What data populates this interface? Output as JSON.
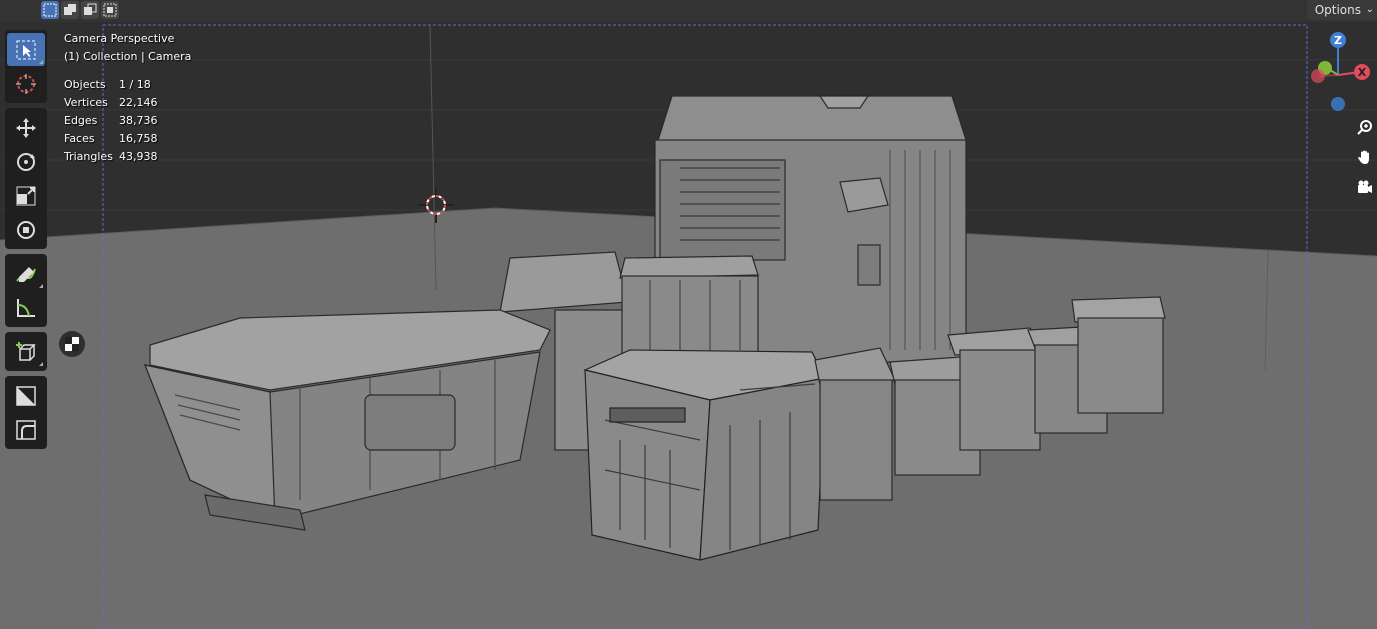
{
  "header": {
    "options_label": "Options",
    "selection_modes": [
      "select-new-icon",
      "select-extend-icon",
      "select-subtract-icon",
      "select-intersect-icon"
    ]
  },
  "toolbar": {
    "tools": [
      "select-box-icon",
      "cursor-icon",
      "move-icon",
      "rotate-icon",
      "scale-icon",
      "transform-icon",
      "annotate-icon",
      "measure-icon",
      "add-cube-icon",
      "shade-icon",
      "bevel-icon"
    ]
  },
  "overlay": {
    "view_name": "Camera Perspective",
    "collection_line": "(1) Collection | Camera",
    "stats": [
      {
        "label": "Objects",
        "value": "1 / 18"
      },
      {
        "label": "Vertices",
        "value": "22,146"
      },
      {
        "label": "Edges",
        "value": "38,736"
      },
      {
        "label": "Faces",
        "value": "16,758"
      },
      {
        "label": "Triangles",
        "value": "43,938"
      }
    ]
  },
  "gizmo": {
    "z_label": "Z",
    "x_label": "X",
    "y_label": "Y",
    "colors": {
      "x": "#e04c5c",
      "y": "#7fb73b",
      "z": "#3f80d6"
    }
  },
  "nav_icons": [
    "zoom-icon",
    "hand-pan-icon",
    "camera-view-icon"
  ],
  "colors": {
    "accent": "#4772b3",
    "background": "#2b2b2b",
    "floor": "#6f6f6f"
  }
}
